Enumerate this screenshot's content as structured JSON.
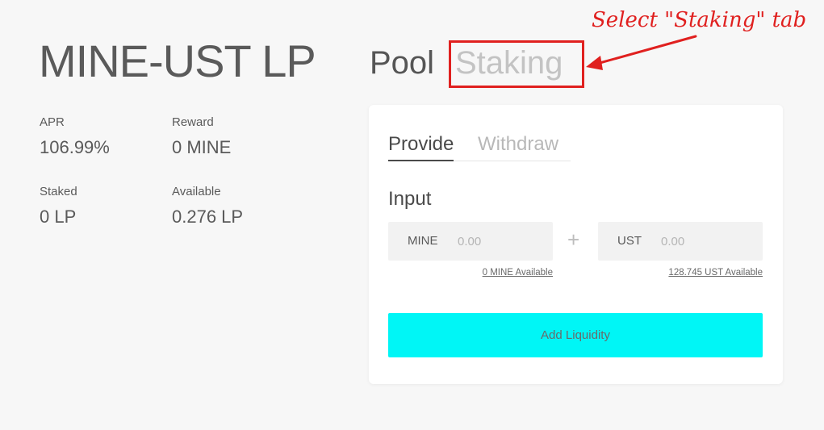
{
  "title": "MINE-UST LP",
  "stats": {
    "apr": {
      "label": "APR",
      "value": "106.99%"
    },
    "reward": {
      "label": "Reward",
      "value": "0 MINE"
    },
    "staked": {
      "label": "Staked",
      "value": "0 LP"
    },
    "available": {
      "label": "Available",
      "value": "0.276 LP"
    }
  },
  "main_tabs": {
    "pool": "Pool",
    "staking": "Staking"
  },
  "annotation": {
    "text": "Select \"Staking\" tab",
    "color": "#e0201f"
  },
  "card": {
    "tabs": {
      "provide": "Provide",
      "withdraw": "Withdraw"
    },
    "input_label": "Input",
    "mine_field": {
      "token": "MINE",
      "placeholder": "0.00",
      "available": "0 MINE Available"
    },
    "plus": "+",
    "ust_field": {
      "token": "UST",
      "placeholder": "0.00",
      "available": "128.745 UST Available"
    },
    "add_button": "Add Liquidity"
  },
  "colors": {
    "accent": "#00f6f6",
    "background": "#f7f7f7",
    "card": "#ffffff"
  }
}
